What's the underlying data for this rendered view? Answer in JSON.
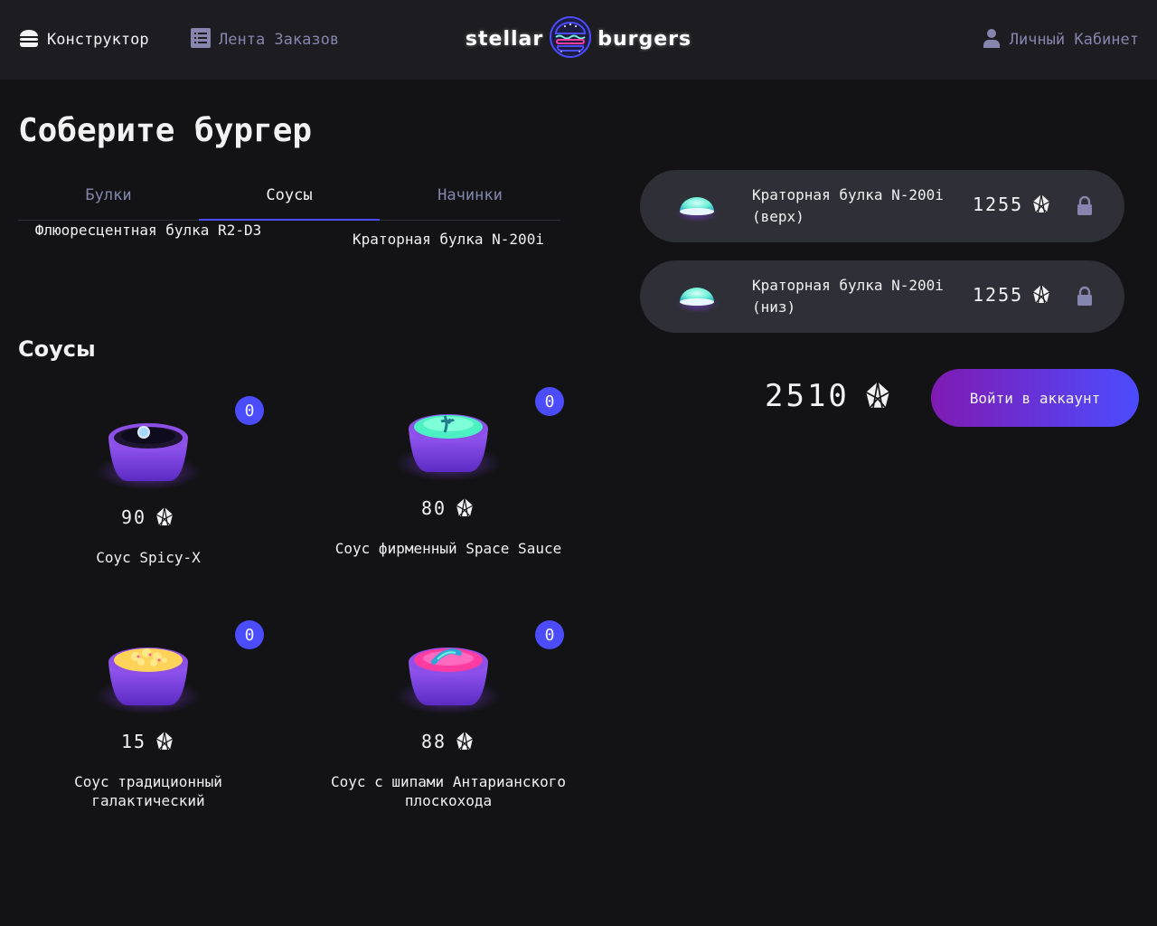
{
  "header": {
    "constructor_label": "Конструктор",
    "feed_label": "Лента Заказов",
    "profile_label": "Личный Кабинет",
    "logo_left": "stellar",
    "logo_right": "burgers"
  },
  "main": {
    "title": "Соберите бургер",
    "tabs": [
      {
        "label": "Булки",
        "active": false
      },
      {
        "label": "Соусы",
        "active": true
      },
      {
        "label": "Начинки",
        "active": false
      }
    ],
    "buns_partial": [
      {
        "name": "Флюоресцентная булка R2-D3"
      },
      {
        "name": "Краторная булка N-200i"
      }
    ],
    "section_heading": "Соусы",
    "sauces": [
      {
        "name": "Соус Spicy-X",
        "price": "90",
        "count": "0",
        "icon": "sauce-spicy-x"
      },
      {
        "name": "Соус фирменный Space Sauce",
        "price": "80",
        "count": "0",
        "icon": "sauce-space"
      },
      {
        "name": "Соус традиционный галактический",
        "price": "15",
        "count": "0",
        "icon": "sauce-galactic"
      },
      {
        "name": "Соус с шипами Антарианского плоскохода",
        "price": "88",
        "count": "0",
        "icon": "sauce-spikes"
      }
    ]
  },
  "burger_constructor": {
    "items": [
      {
        "name": "Краторная булка N-200i (верх)",
        "price": "1255",
        "locked": true
      },
      {
        "name": "Краторная булка N-200i (низ)",
        "price": "1255",
        "locked": true
      }
    ],
    "total": "2510",
    "order_button": "Войти в аккаунт"
  },
  "colors": {
    "background": "#131316",
    "header": "#1c1c21",
    "accent": "#4c4cff",
    "inactive": "#8585ad",
    "card": "#2f2f37",
    "button_gradient_start": "#801ab2",
    "button_gradient_end": "#4c4cff"
  }
}
